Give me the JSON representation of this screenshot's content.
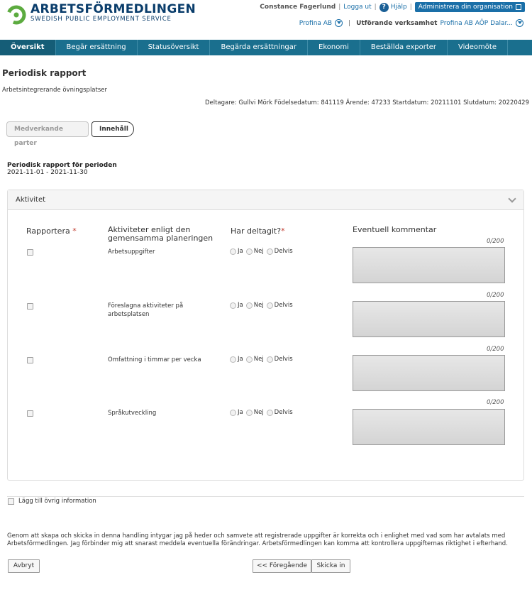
{
  "header": {
    "logo_name": "ARBETSFÖRMEDLINGEN",
    "logo_sub": "SWEDISH PUBLIC EMPLOYMENT SERVICE",
    "user": "Constance Fagerlund",
    "logout": "Logga ut",
    "help": "Hjälp",
    "admin_button": "Administrera din organisation",
    "org": "Profina AB",
    "verksamhet_label": "Utförande verksamhet",
    "verksamhet_value": "Profina AB AÖP Dalar..."
  },
  "nav": {
    "items": [
      "Översikt",
      "Begär ersättning",
      "Statusöversikt",
      "Begärda ersättningar",
      "Ekonomi",
      "Beställda exporter",
      "Videomöte"
    ]
  },
  "page": {
    "title": "Periodisk rapport",
    "subtitle": "Arbetsintegrerande övningsplatser",
    "deltagare": "Deltagare: Gullvi Mörk Födelsedatum: 841119 Ärende: 47233 Startdatum: 20211101 Slutdatum: 20220429"
  },
  "steps": [
    "Medverkande parter",
    "Innehåll"
  ],
  "period": {
    "title": "Periodisk rapport för perioden",
    "dates": "2021-11-01 - 2021-11-30"
  },
  "panel": {
    "title": "Aktivitet",
    "col_rapportera": "Rapportera",
    "col_aktiviteter": "Aktiviteter enligt den gemensamma planeringen",
    "col_deltagit": "Har deltagit?",
    "col_kommentar": "Eventuell kommentar",
    "radio_labels": [
      "Ja",
      "Nej",
      "Delvis"
    ],
    "rows": [
      {
        "label": "Arbetsuppgifter",
        "counter": "0/200"
      },
      {
        "label": "Föreslagna aktiviteter på arbetsplatsen",
        "counter": "0/200"
      },
      {
        "label": "Omfattning i timmar per vecka",
        "counter": "0/200"
      },
      {
        "label": "Språkutveckling",
        "counter": "0/200"
      }
    ]
  },
  "extra_info": "Lägg till övrig information",
  "declaration": "Genom att skapa och skicka in denna handling intygar jag på heder och samvete att registrerade uppgifter är korrekta och i enlighet med vad som har avtalats med Arbetsförmedlingen. Jag förbinder mig att snarast meddela eventuella förändringar. Arbetsförmedlingen kan komma att kontrollera uppgifternas riktighet i efterhand.",
  "buttons": {
    "cancel": "Avbryt",
    "previous": "<< Föregående",
    "submit": "Skicka in"
  },
  "colors": {
    "nav_bg": "#1a6f8e",
    "brand": "#0a3d6b",
    "logo_green": "#5cab3f",
    "link": "#1a6fa8"
  }
}
